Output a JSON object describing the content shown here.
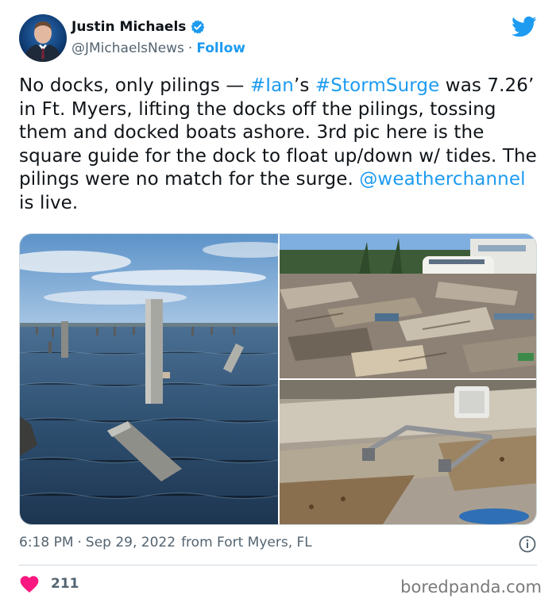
{
  "author": {
    "name": "Justin Michaels",
    "handle": "@JMichaelsNews",
    "separator": "·",
    "follow_label": "Follow"
  },
  "icons": {
    "avatar": "avatar-photo",
    "verified": "verified-badge-icon",
    "platform": "twitter-bird-icon",
    "info": "info-icon",
    "like": "heart-icon"
  },
  "colors": {
    "link": "#1d9bf0",
    "text": "#0f1419",
    "muted": "#536471",
    "heart": "#f91880"
  },
  "tweet": {
    "segments": [
      {
        "text": "No docks, only pilings — ",
        "type": "text"
      },
      {
        "text": "#Ian",
        "type": "link"
      },
      {
        "text": "’s ",
        "type": "text"
      },
      {
        "text": "#StormSurge",
        "type": "link"
      },
      {
        "text": " was 7.26’ in Ft. Myers, lifting the docks off the pilings, tossing them and docked boats ashore. 3rd pic here is the square guide for the dock to float up/down w/ tides. The pilings were no match for the surge. ",
        "type": "text"
      },
      {
        "text": "@weatherchannel",
        "type": "link"
      },
      {
        "text": " is live.",
        "type": "text"
      }
    ]
  },
  "media": {
    "images": [
      {
        "name": "pilings-in-water-photo"
      },
      {
        "name": "storm-debris-boats-photo"
      },
      {
        "name": "dock-guide-photo"
      }
    ]
  },
  "meta": {
    "time": "6:18 PM",
    "separator": "·",
    "date": "Sep 29, 2022",
    "source": "from Fort Myers, FL"
  },
  "engagement": {
    "likes": "211"
  },
  "watermark": "boredpanda.com"
}
